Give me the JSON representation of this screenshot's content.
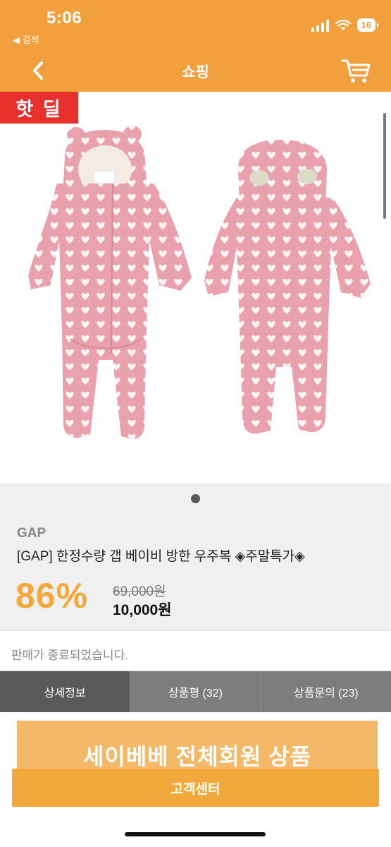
{
  "status_bar": {
    "time": "5:06",
    "back_app": "◀ 검색",
    "battery": "16"
  },
  "header": {
    "title": "쇼핑",
    "back_icon": "chevron-left-icon",
    "cart_icon": "cart-icon"
  },
  "product": {
    "badge": "핫 딜",
    "brand": "GAP",
    "title": "[GAP] 한정수량 갭 베이비 방한 우주복 ◈주말특가◈",
    "discount": "86%",
    "original_price": "69,000원",
    "sale_price": "10,000원",
    "sold_out_notice": "판매가 종료되었습니다."
  },
  "tabs": [
    {
      "label": "상세정보",
      "active": true
    },
    {
      "label": "상품평 (32)",
      "active": false
    },
    {
      "label": "상품문의 (23)",
      "active": false
    }
  ],
  "banner": {
    "text": "세이베베 전체회원 상품"
  },
  "bottom_button": {
    "label": "고객센터"
  },
  "colors": {
    "accent": "#f2a03d",
    "hot_badge": "#e8302c",
    "discount": "#f5a83a",
    "suit_pink": "#e9a2ad"
  }
}
